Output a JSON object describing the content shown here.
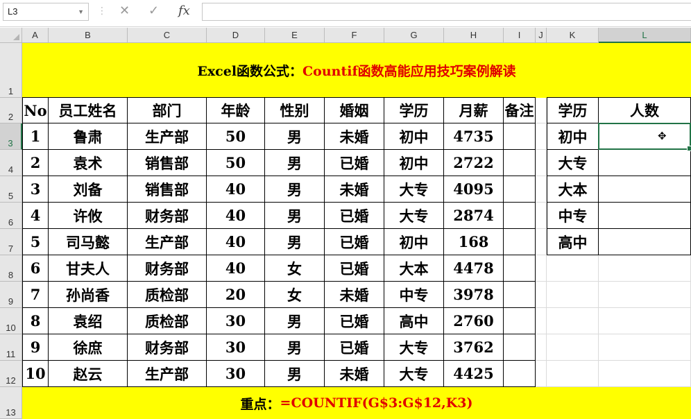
{
  "name_box": "L3",
  "formula_icons": {
    "cancel": "✕",
    "enter": "✓",
    "function": "fx"
  },
  "formula_value": "",
  "columns": [
    "A",
    "B",
    "C",
    "D",
    "E",
    "F",
    "G",
    "H",
    "I",
    "J",
    "K",
    "L"
  ],
  "rows": [
    "1",
    "2",
    "3",
    "4",
    "5",
    "6",
    "7",
    "8",
    "9",
    "10",
    "11",
    "12",
    "13"
  ],
  "title": {
    "black": "Excel函数公式：",
    "red": "Countif函数高能应用技巧案例解读"
  },
  "table": {
    "headers": [
      "No",
      "员工姓名",
      "部门",
      "年龄",
      "性别",
      "婚姻",
      "学历",
      "月薪",
      "备注"
    ],
    "rows": [
      [
        "1",
        "鲁肃",
        "生产部",
        "50",
        "男",
        "未婚",
        "初中",
        "4735",
        ""
      ],
      [
        "2",
        "袁术",
        "销售部",
        "50",
        "男",
        "已婚",
        "初中",
        "2722",
        ""
      ],
      [
        "3",
        "刘备",
        "销售部",
        "40",
        "男",
        "未婚",
        "大专",
        "4095",
        ""
      ],
      [
        "4",
        "许攸",
        "财务部",
        "40",
        "男",
        "已婚",
        "大专",
        "2874",
        ""
      ],
      [
        "5",
        "司马懿",
        "生产部",
        "40",
        "男",
        "已婚",
        "初中",
        "168",
        ""
      ],
      [
        "6",
        "甘夫人",
        "财务部",
        "40",
        "女",
        "已婚",
        "大本",
        "4478",
        ""
      ],
      [
        "7",
        "孙尚香",
        "质检部",
        "20",
        "女",
        "未婚",
        "中专",
        "3978",
        ""
      ],
      [
        "8",
        "袁绍",
        "质检部",
        "30",
        "男",
        "已婚",
        "高中",
        "2760",
        ""
      ],
      [
        "9",
        "徐庶",
        "财务部",
        "30",
        "男",
        "已婚",
        "大专",
        "3762",
        ""
      ],
      [
        "10",
        "赵云",
        "生产部",
        "30",
        "男",
        "未婚",
        "大专",
        "4425",
        ""
      ]
    ]
  },
  "summary": {
    "headers": [
      "学历",
      "人数"
    ],
    "rows": [
      [
        "初中",
        ""
      ],
      [
        "大专",
        ""
      ],
      [
        "大本",
        ""
      ],
      [
        "中专",
        ""
      ],
      [
        "高中",
        ""
      ]
    ]
  },
  "note": {
    "black": "重点：",
    "red": "=COUNTIF(G$3:G$12,K3)"
  },
  "colors": {
    "highlight": "#ffff00",
    "accent_red": "#e00000",
    "selection": "#217346"
  },
  "cursor_icon": "cell-cursor-icon"
}
